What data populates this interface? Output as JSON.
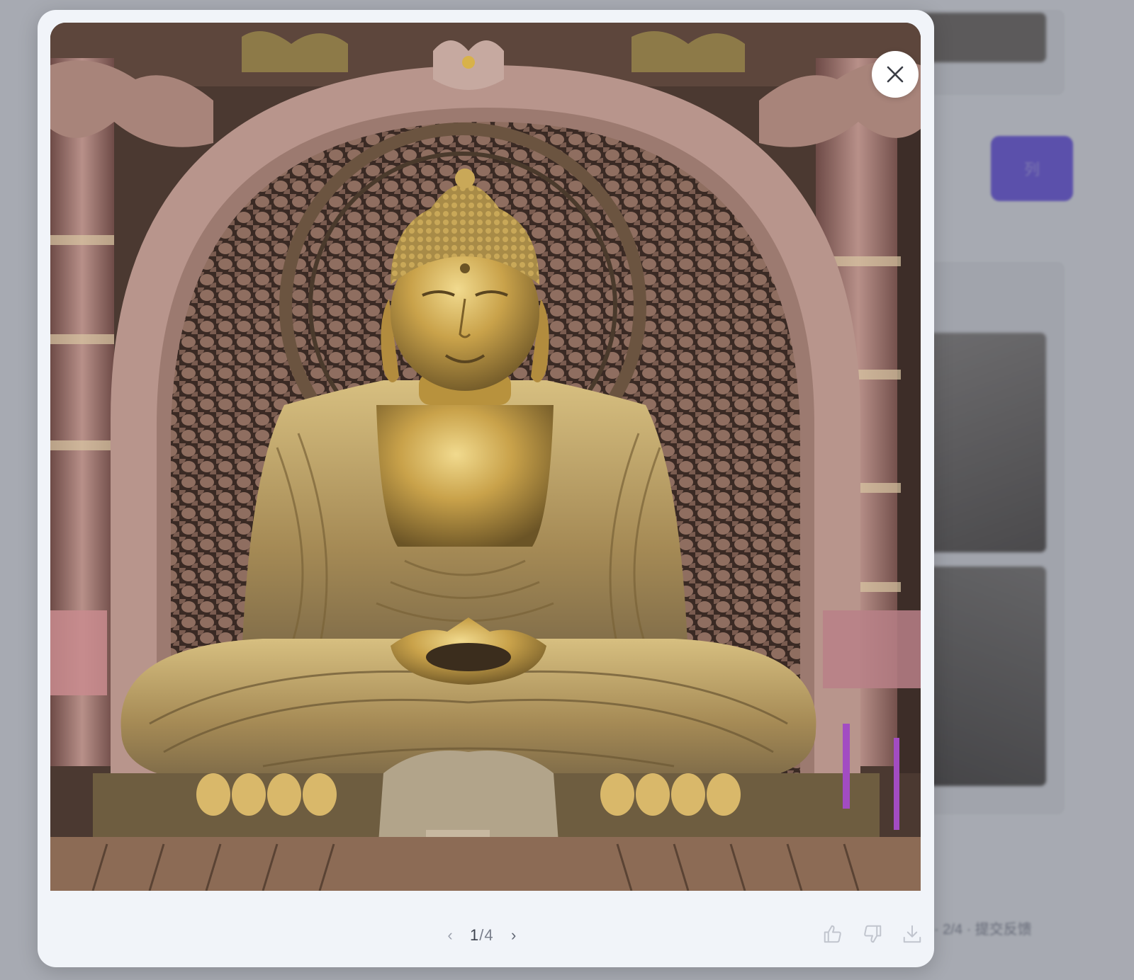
{
  "background": {
    "button_label": "列",
    "footer_text": "· 2/4 · 提交反馈"
  },
  "image": {
    "subject": "golden seated buddha statue in ornate temple niche"
  },
  "pager": {
    "prev_icon": "chevron-left-icon",
    "current": "1",
    "separator": "/",
    "total": "4",
    "next_icon": "chevron-right-icon"
  },
  "actions": {
    "icons": [
      "thumbs-up-icon",
      "thumbs-down-icon",
      "download-icon"
    ]
  },
  "colors": {
    "accent": "#6b55e8",
    "modal_bg": "#f1f4f9",
    "gold": "#c9a24a"
  }
}
